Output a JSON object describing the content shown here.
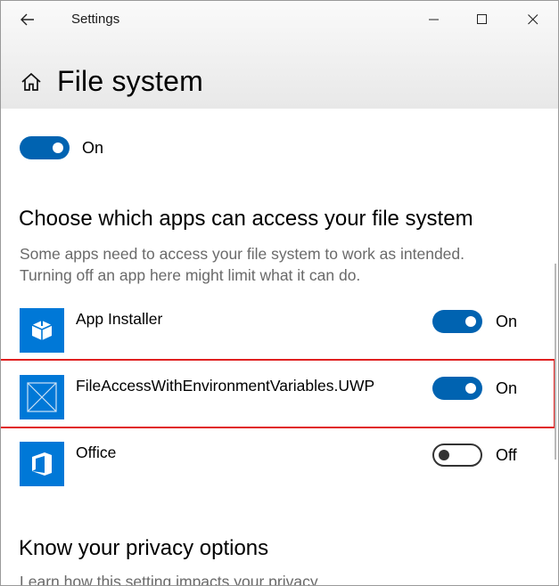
{
  "window": {
    "title": "Settings",
    "controls": {
      "minimize": "minimize-icon",
      "maximize": "maximize-icon",
      "close": "close-icon"
    }
  },
  "header": {
    "title": "File system",
    "home_icon": "home-icon",
    "back_icon": "arrow-left-icon"
  },
  "master_toggle": {
    "state": "on",
    "label": "On"
  },
  "apps_section": {
    "title": "Choose which apps can access your file system",
    "description_line1": "Some apps need to access your file system to work as intended.",
    "description_line2": "Turning off an app here might limit what it can do."
  },
  "apps": [
    {
      "name": "App Installer",
      "icon": "package-box-icon",
      "state": "on",
      "state_label": "On"
    },
    {
      "name": "FileAccessWithEnvironmentVariables.UWP",
      "icon": "placeholder-app-icon",
      "state": "on",
      "state_label": "On",
      "highlighted": true
    },
    {
      "name": "Office",
      "icon": "office-logo-icon",
      "state": "off",
      "state_label": "Off"
    }
  ],
  "privacy_section": {
    "title": "Know your privacy options",
    "description": "Learn how this setting impacts your privacy."
  },
  "colors": {
    "accent": "#0063b1",
    "tile_blue": "#0078d7",
    "highlight_border": "#e02020",
    "secondary_text": "#6a6a6a"
  }
}
